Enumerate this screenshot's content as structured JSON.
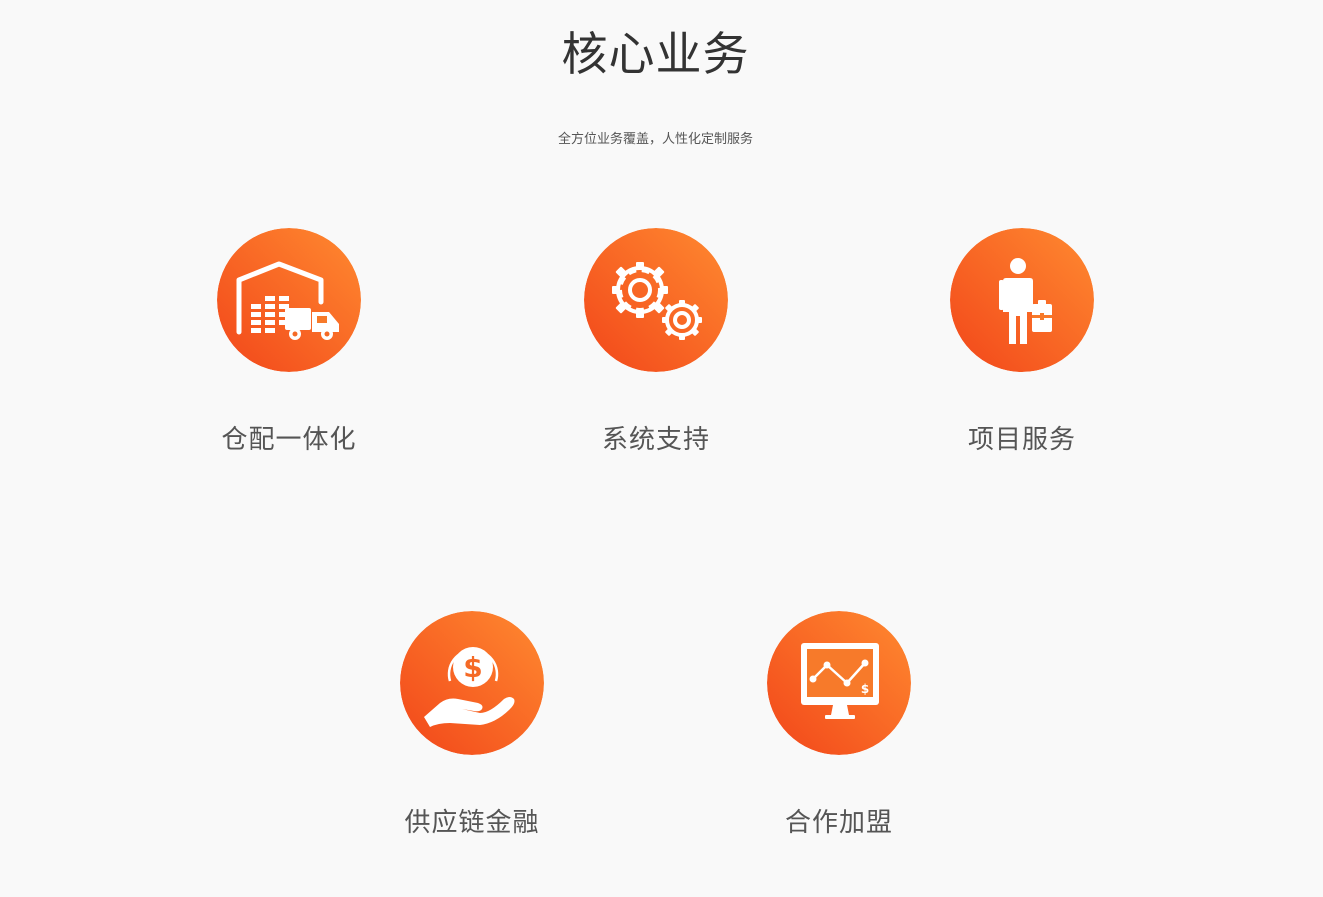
{
  "section": {
    "title": "核心业务",
    "subtitle": "全方位业务覆盖，人性化定制服务"
  },
  "theme": {
    "circle_gradient_start": "#f2461a",
    "circle_gradient_end": "#ff8a30",
    "icon_color": "#ffffff",
    "background": "#f9f9f9",
    "label_color": "#555555"
  },
  "services": [
    {
      "label": "仓配一体化",
      "icon": "warehouse-truck-icon"
    },
    {
      "label": "系统支持",
      "icon": "gears-icon"
    },
    {
      "label": "项目服务",
      "icon": "businessman-briefcase-icon"
    },
    {
      "label": "供应链金融",
      "icon": "hand-coin-icon"
    },
    {
      "label": "合作加盟",
      "icon": "monitor-chart-icon"
    }
  ]
}
